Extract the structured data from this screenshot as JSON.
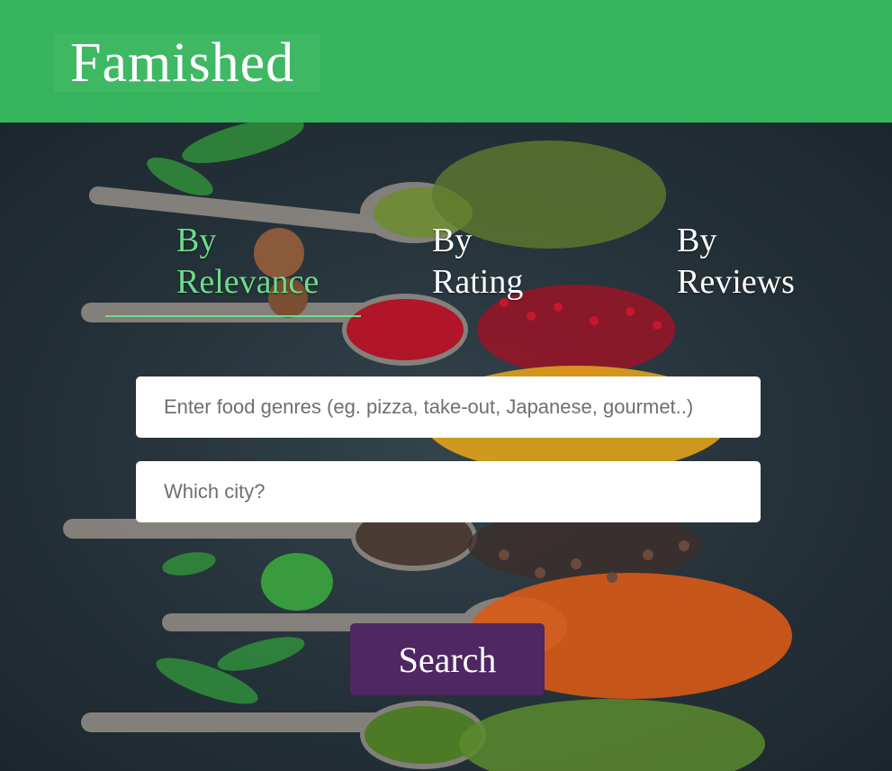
{
  "app": {
    "title": "Famished"
  },
  "tabs": [
    {
      "label_line1": "By",
      "label_line2": "Relevance",
      "active": true
    },
    {
      "label_line1": "By",
      "label_line2": "Rating",
      "active": false
    },
    {
      "label_line1": "By",
      "label_line2": "Reviews",
      "active": false
    }
  ],
  "search": {
    "genres_placeholder": "Enter food genres (eg. pizza, take-out, Japanese, gourmet..)",
    "city_placeholder": "Which city?",
    "button_label": "Search"
  },
  "colors": {
    "header": "#36b55d",
    "active_tab": "#6ddc8b",
    "button": "#4f2762"
  }
}
